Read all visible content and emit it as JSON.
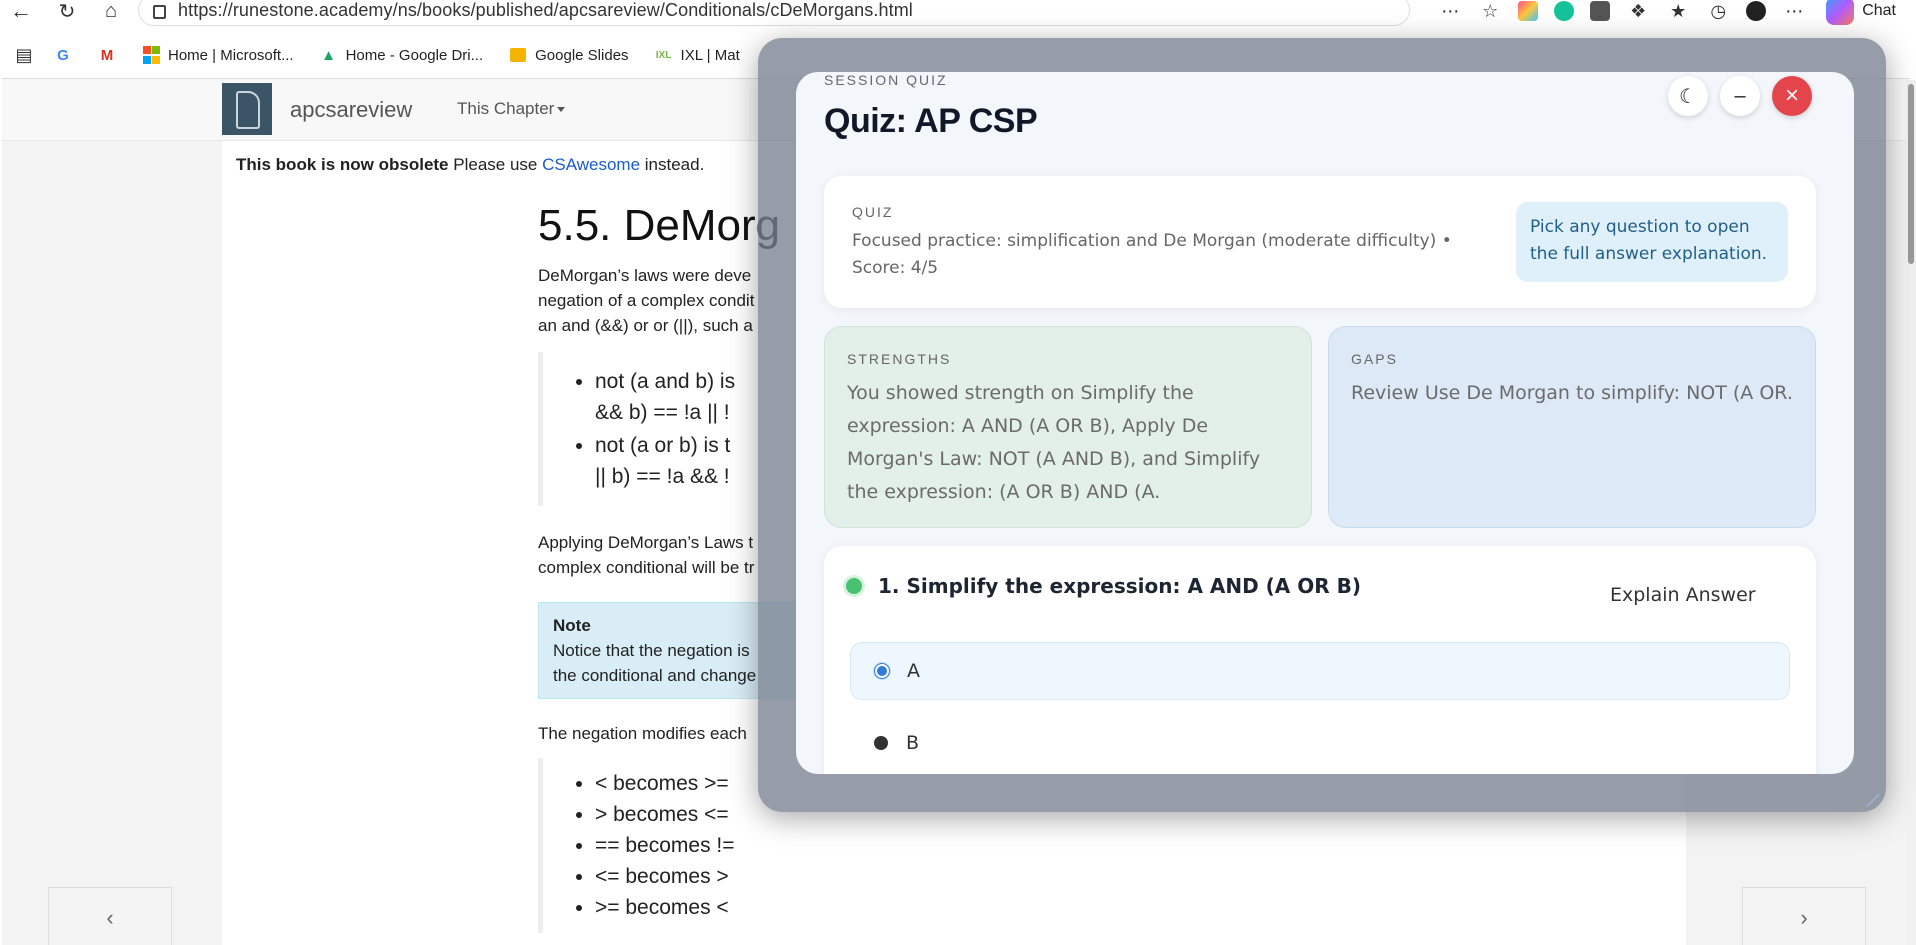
{
  "browser": {
    "url": "https://runestone.academy/ns/books/published/apcsareview/Conditionals/cDeMorgans.html",
    "chat_label": "Chat",
    "bookmarks": [
      {
        "label": "",
        "icon": "G",
        "color": "#4285f4"
      },
      {
        "label": "",
        "icon": "M",
        "color": "#d93025"
      },
      {
        "label": "Home | Microsoft...",
        "icon": "ms",
        "color": "#f25022"
      },
      {
        "label": "Home - Google Dri...",
        "icon": "drive",
        "color": "#1fa463"
      },
      {
        "label": "Google Slides",
        "icon": "slides",
        "color": "#f4b400"
      },
      {
        "label": "IXL | Mat",
        "icon": "IXL",
        "color": "#7cb342"
      }
    ]
  },
  "site": {
    "brand": "apcsareview",
    "chapter_menu": "This Chapter",
    "obsolete_bold": "This book is now obsolete",
    "obsolete_pre": " Please use ",
    "obsolete_link": "CSAwesome",
    "obsolete_post": " instead."
  },
  "article": {
    "title": "5.5. DeMorg",
    "intro": [
      "DeMorgan’s laws were deve",
      "negation of a complex condit",
      "an and (&&) or or (||), such a"
    ],
    "laws": [
      {
        "line1": "not (a and b) is",
        "line2": "&& b) == !a || !"
      },
      {
        "line1": "not (a or b) is t",
        "line2": "|| b) == !a && !"
      }
    ],
    "applying": [
      "Applying DeMorgan’s Laws t",
      "complex conditional will be tr"
    ],
    "note_title": "Note",
    "note_lines": [
      "Notice that the negation is",
      "the conditional and change"
    ],
    "negation_intro": "The negation modifies each",
    "ops": [
      "< becomes >=",
      "> becomes <=",
      "== becomes !=",
      "<= becomes >",
      ">= becomes <"
    ]
  },
  "quiz": {
    "kicker": "SESSION QUIZ",
    "title": "Quiz: AP CSP",
    "summary_label": "QUIZ",
    "summary_text": "Focused practice: simplification and De Morgan (moderate difficulty) • Score: 4/5",
    "hint": "Pick any question to open the full answer explanation.",
    "strengths_label": "STRENGTHS",
    "strengths_text": "You showed strength on Simplify the expression: A AND (A OR B), Apply De Morgan's Law: NOT (A AND B), and Simplify the expression: (A OR B) AND (A.",
    "gaps_label": "GAPS",
    "gaps_text": "Review Use De Morgan to simplify: NOT (A OR.",
    "question": {
      "text": "1. Simplify the expression: A AND (A OR B)",
      "explain_label": "Explain Answer",
      "options": [
        "A",
        "B"
      ]
    },
    "icons": {
      "theme": "moon-icon",
      "minimize": "minus-icon",
      "close": "close-icon"
    }
  }
}
